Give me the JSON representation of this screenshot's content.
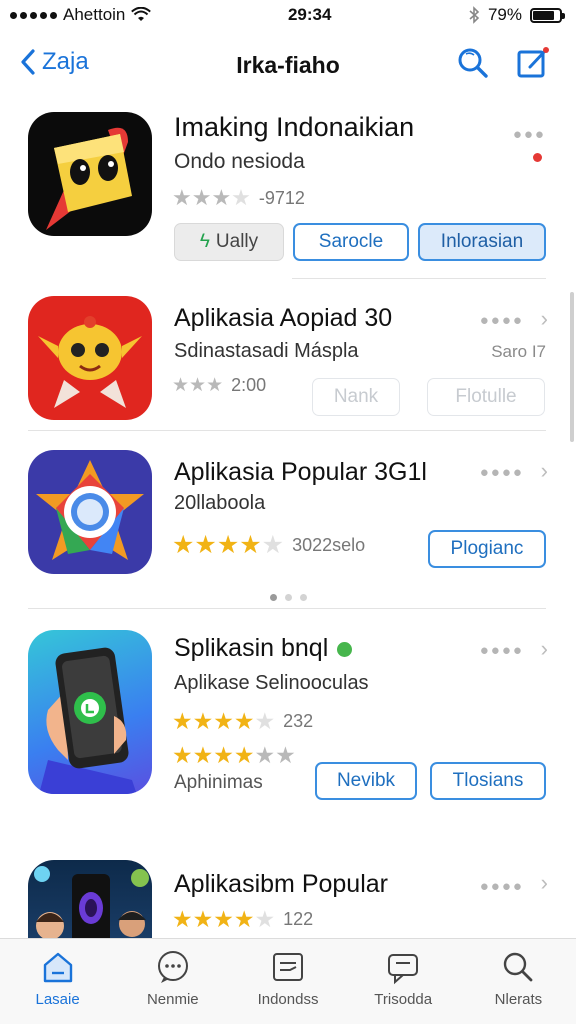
{
  "status": {
    "carrier": "Ahettoin",
    "time": "29:34",
    "battery": "79%",
    "battery_level": 0.79
  },
  "nav": {
    "back_label": "Zaja",
    "title": "Irka-fiaho",
    "icons": [
      "search-icon",
      "compose-icon"
    ]
  },
  "apps": [
    {
      "name": "Imaking Indonaikian",
      "subtitle": "Ondo nesioda",
      "rating_text": "-9712",
      "stars": 3,
      "buttons": [
        "Ually",
        "Sarocle",
        "Inlorasian"
      ]
    },
    {
      "name": "Aplikasia Aopiad 30",
      "subtitle": "Sdinastasadi Máspla",
      "rating_text": "2:00",
      "side_note": "Saro I7",
      "stars": 3,
      "buttons": [
        "Nank",
        "Flotulle"
      ]
    },
    {
      "name": "Aplikasia Popular 3G1l",
      "subtitle": "20llaboola",
      "rating_text": "3022selo",
      "stars": 4,
      "buttons": [
        "Plogianc"
      ]
    },
    {
      "name": "Splikasin bnql",
      "subtitle": "Aplikase Selinooculas",
      "rating_text": "232",
      "stars": 4,
      "second_stars": 3.5,
      "extra_text": "Aphinimas",
      "buttons": [
        "Nevibk",
        "Tlosians"
      ]
    },
    {
      "name": "Aplikasibm Popular",
      "rating_text": "122",
      "stars": 4
    }
  ],
  "tabs": [
    {
      "label": "Lasaie",
      "icon": "home-icon"
    },
    {
      "label": "Nenmie",
      "icon": "chat-icon"
    },
    {
      "label": "Indondss",
      "icon": "tablet-icon"
    },
    {
      "label": "Trisodda",
      "icon": "messages-icon"
    },
    {
      "label": "Nlerats",
      "icon": "search-icon"
    }
  ],
  "colors": {
    "accent": "#1a73d9",
    "star": "#f1b315",
    "button_border": "#3a8ee0"
  }
}
